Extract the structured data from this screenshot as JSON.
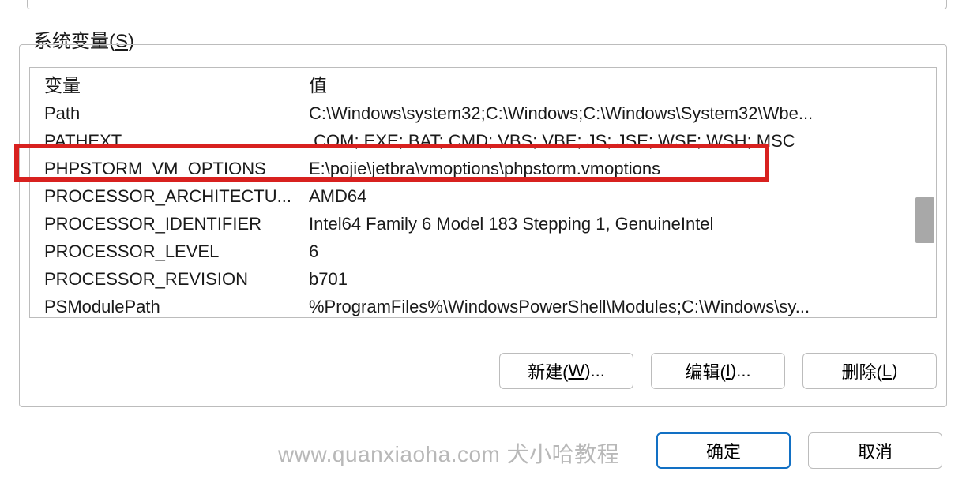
{
  "group_label_pre": "系统变量(",
  "group_label_u": "S",
  "group_label_post": ")",
  "header": {
    "var": "变量",
    "val": "值"
  },
  "rows": [
    {
      "var": "Path",
      "val": "C:\\Windows\\system32;C:\\Windows;C:\\Windows\\System32\\Wbe..."
    },
    {
      "var": "PATHEXT",
      "val": ".COM;.EXE;.BAT;.CMD;.VBS;.VBE;.JS;.JSE;.WSF;.WSH;.MSC"
    },
    {
      "var": "PHPSTORM_VM_OPTIONS",
      "val": "E:\\pojie\\jetbra\\vmoptions\\phpstorm.vmoptions"
    },
    {
      "var": "PROCESSOR_ARCHITECTU...",
      "val": "AMD64"
    },
    {
      "var": "PROCESSOR_IDENTIFIER",
      "val": "Intel64 Family 6 Model 183 Stepping 1, GenuineIntel"
    },
    {
      "var": "PROCESSOR_LEVEL",
      "val": "6"
    },
    {
      "var": "PROCESSOR_REVISION",
      "val": "b701"
    },
    {
      "var": "PSModulePath",
      "val": "%ProgramFiles%\\WindowsPowerShell\\Modules;C:\\Windows\\sy..."
    }
  ],
  "buttons": {
    "new_pre": "新建(",
    "new_u": "W",
    "new_post": ")...",
    "edit_pre": "编辑(",
    "edit_u": "I",
    "edit_post": ")...",
    "delete_pre": "删除(",
    "delete_u": "L",
    "delete_post": ")"
  },
  "dialog": {
    "ok": "确定",
    "cancel": "取消"
  },
  "watermark": "www.quanxiaoha.com 犬小哈教程"
}
